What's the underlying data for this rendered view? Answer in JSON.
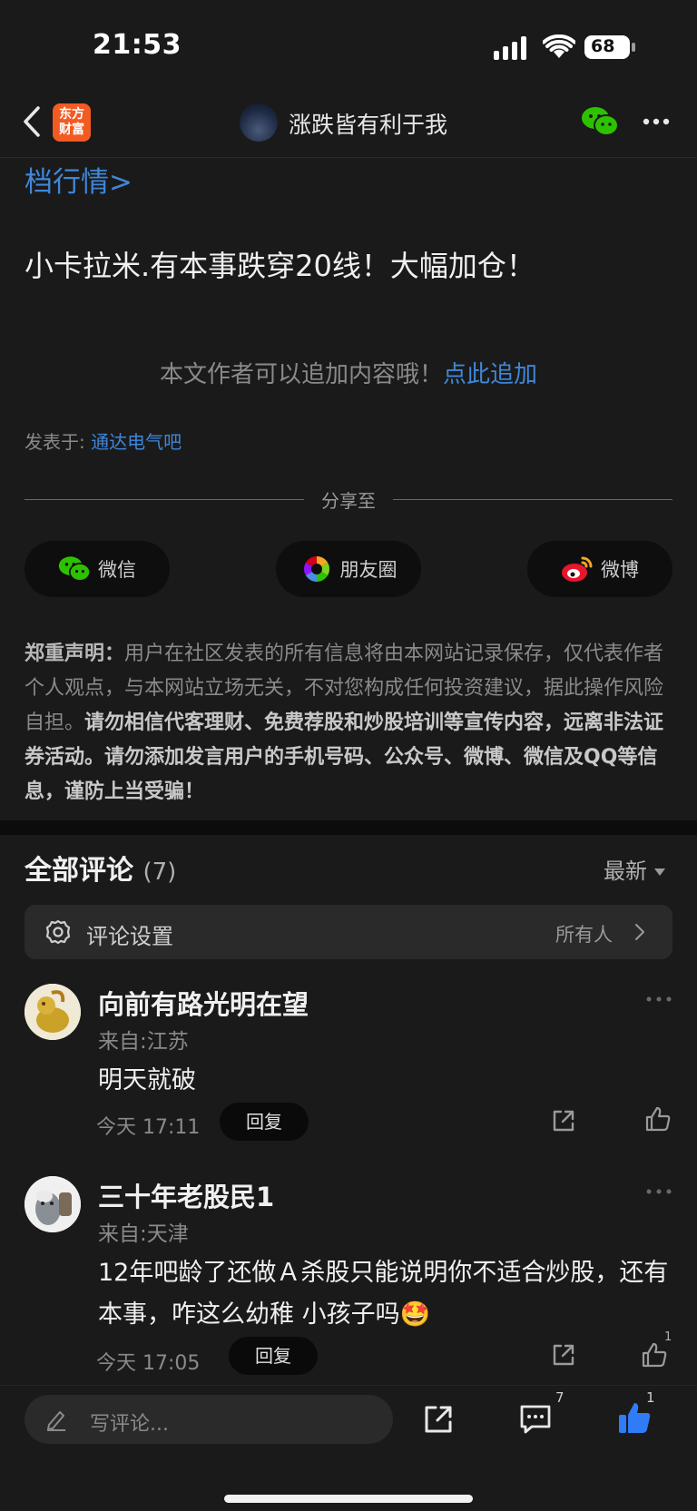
{
  "status_bar": {
    "time": "21:53",
    "battery": "68"
  },
  "header": {
    "logo_line1": "东方",
    "logo_line2": "财富",
    "title": "涨跌皆有利于我"
  },
  "article": {
    "quote_link": "档行情>",
    "text": "小卡拉米.有本事跌穿20线！大幅加仓！",
    "append_prompt": "本文作者可以追加内容哦！",
    "append_link": "点此追加",
    "posted_label": "发表于:",
    "posted_forum": "通达电气吧"
  },
  "share": {
    "title": "分享至",
    "buttons": [
      {
        "label": "微信",
        "icon": "wechat-icon"
      },
      {
        "label": "朋友圈",
        "icon": "moments-icon"
      },
      {
        "label": "微博",
        "icon": "weibo-icon"
      }
    ]
  },
  "disclaimer": {
    "heading": "郑重声明：",
    "normal": "用户在社区发表的所有信息将由本网站记录保存，仅代表作者个人观点，与本网站立场无关，不对您构成任何投资建议，据此操作风险自担。",
    "strong": "请勿相信代客理财、免费荐股和炒股培训等宣传内容，远离非法证券活动。请勿添加发言用户的手机号码、公众号、微博、微信及QQ等信息，谨防上当受骗！"
  },
  "comments_section": {
    "title": "全部评论",
    "count": "(7)",
    "sort_label": "最新",
    "settings_label": "评论设置",
    "settings_value": "所有人"
  },
  "comments": [
    {
      "name": "向前有路光明在望",
      "location": "来自:江苏",
      "text": "明天就破",
      "time": "今天 17:11",
      "reply": "回复",
      "likes": ""
    },
    {
      "name": "三十年老股民1",
      "location": "来自:天津",
      "text": "12年吧龄了还做Ａ杀股只能说明你不适合炒股，还有本事，咋这么幼稚 小孩子吗🤩",
      "time": "今天 17:05",
      "reply": "回复",
      "likes": "1"
    }
  ],
  "bottom_bar": {
    "placeholder": "写评论...",
    "comment_count": "7",
    "like_count": "1"
  },
  "colors": {
    "accent_blue": "#3f87d9",
    "logo_orange": "#f25b21",
    "wechat_green": "#2dc100",
    "like_blue": "#2f7cf6"
  }
}
